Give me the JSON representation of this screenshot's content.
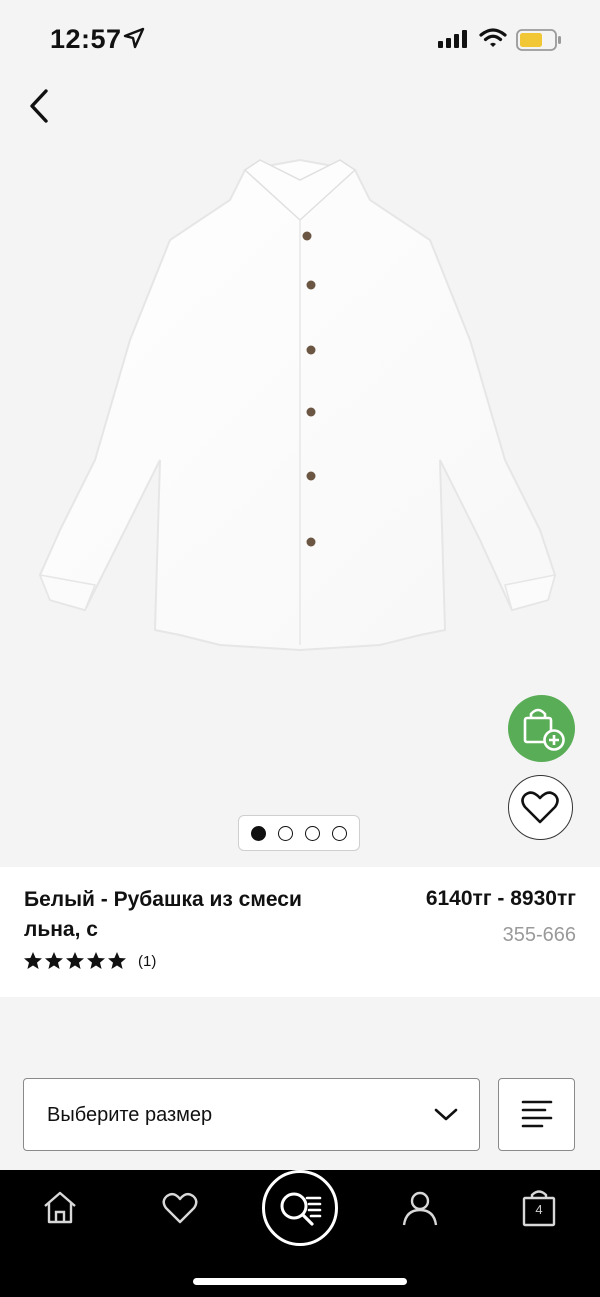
{
  "status": {
    "time": "12:57"
  },
  "product": {
    "title": "Белый - Рубашка из смеси льна, с",
    "price": "6140тг - 8930тг",
    "sku": "355-666",
    "rating": 5,
    "review_count": "(1)",
    "image_dots": 4,
    "active_dot": 1
  },
  "size": {
    "placeholder": "Выберите размер"
  },
  "tabbar": {
    "bag_count": "4"
  },
  "colors": {
    "accent_green": "#5aad57",
    "tabbar_bg": "#000000"
  },
  "icons": [
    "location-arrow-icon",
    "signal-icon",
    "wifi-icon",
    "battery-icon",
    "back-icon",
    "add-to-bag-icon",
    "heart-icon",
    "chevron-down-icon",
    "filter-icon",
    "home-icon",
    "wishlist-icon",
    "search-icon",
    "account-icon",
    "bag-icon"
  ]
}
